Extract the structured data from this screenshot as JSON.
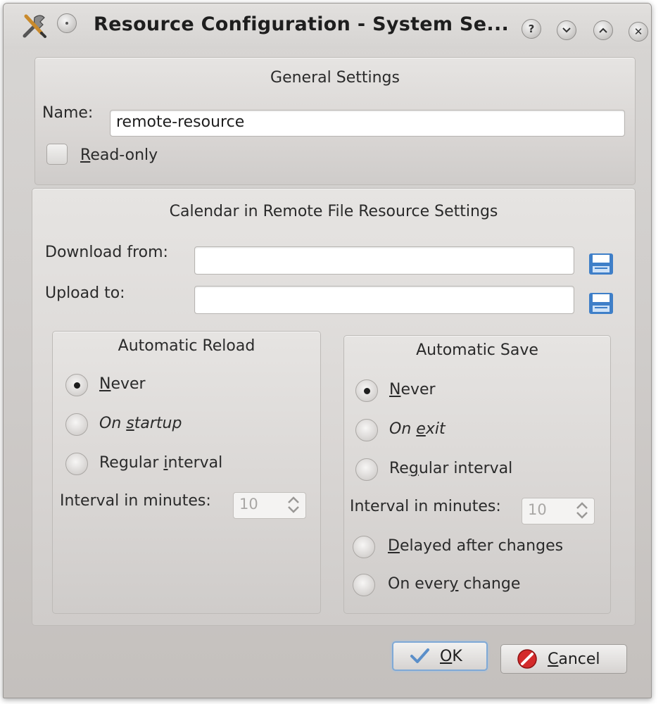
{
  "window": {
    "title": "Resource Configuration - System Se..."
  },
  "titlebar_icons": {
    "app": "tools-icon",
    "pin": "pin-icon",
    "help": "help-icon",
    "minimize": "chevron-down-icon",
    "maximize": "chevron-up-icon",
    "close": "close-icon",
    "help_glyph": "?",
    "close_glyph": "✕"
  },
  "general": {
    "title": "General Settings",
    "name_label": "Name:",
    "name_value": "remote-resource",
    "readonly_label_mn": "R",
    "readonly_label_rest": "ead-only",
    "readonly_checked": false
  },
  "remote": {
    "title": "Calendar in Remote File Resource Settings",
    "download_label": "Download from:",
    "download_value": "",
    "upload_label": "Upload to:",
    "upload_value": "",
    "file_icon": "save-file-icon"
  },
  "reload": {
    "title": "Automatic Reload",
    "never_mn": "N",
    "never_rest": "ever",
    "startup_pre": "On ",
    "startup_mn": "s",
    "startup_rest": "tartup",
    "interval_pre": "Regular ",
    "interval_mn": "i",
    "interval_rest": "nterval",
    "selected": "Never",
    "minutes_label": "Interval in minutes:",
    "minutes_value": "10"
  },
  "save": {
    "title": "Automatic Save",
    "never_mn": "N",
    "never_rest": "ever",
    "exit_pre": "On ",
    "exit_mn": "e",
    "exit_rest": "xit",
    "interval_pre": "Re",
    "interval_mn": "g",
    "interval_rest": "ular interval",
    "minutes_label": "Interval in minutes:",
    "minutes_value": "10",
    "delayed_mn": "D",
    "delayed_rest": "elayed after changes",
    "every_pre": "On ever",
    "every_mn": "y",
    "every_rest": " change",
    "selected": "Never"
  },
  "buttons": {
    "ok_mn": "O",
    "ok_rest": "K",
    "cancel_mn": "C",
    "cancel_rest": "ancel",
    "ok_icon": "checkmark-icon",
    "cancel_icon": "cancel-icon"
  },
  "colors": {
    "accent": "#7fa9d6",
    "cancel_red": "#d42a2a",
    "file_icon_blue": "#3f7fc8"
  }
}
